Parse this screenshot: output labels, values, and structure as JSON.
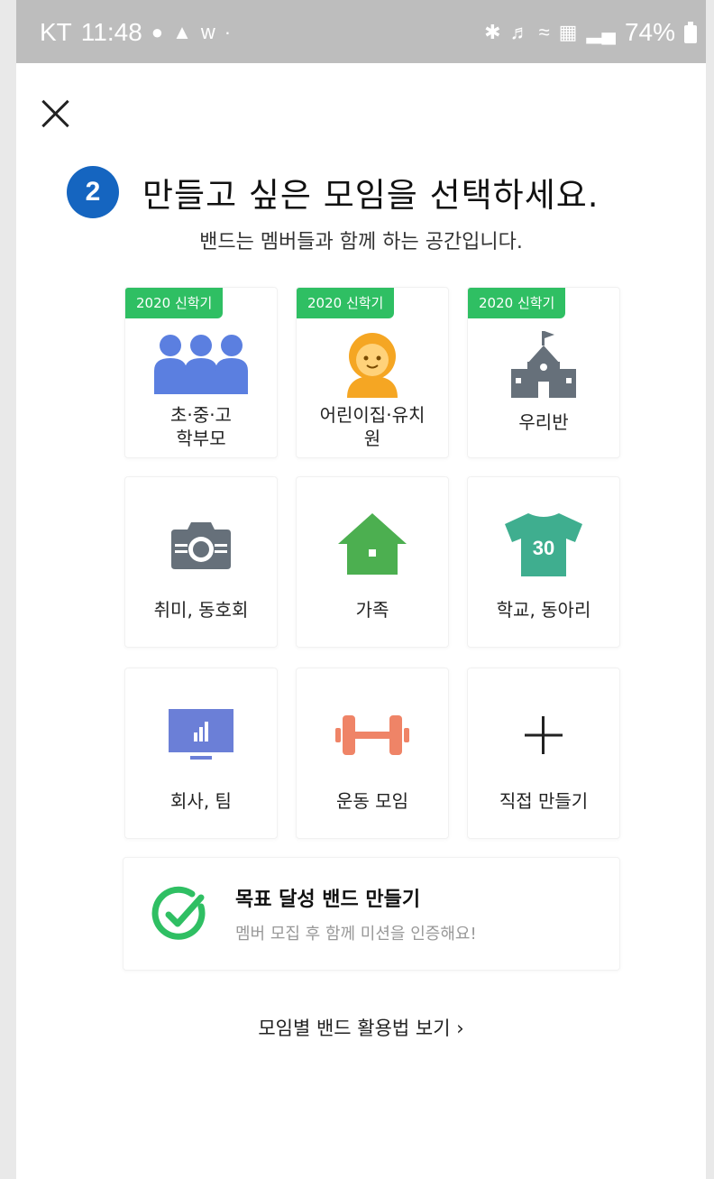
{
  "status_bar": {
    "carrier": "KT",
    "time": "11:48",
    "letter": "w",
    "battery": "74%"
  },
  "header": {
    "step_number": "2",
    "title": "만들고 싶은 모임을 선택하세요.",
    "subtitle": "밴드는 멤버들과 함께 하는 공간입니다."
  },
  "categories": [
    {
      "tag": "2020 신학기",
      "label_line1": "초·중·고",
      "label_line2": "학부모",
      "icon": "parents-group-icon",
      "color": "#5b7fe0"
    },
    {
      "tag": "2020 신학기",
      "label_line1": "어린이집·유치",
      "label_line2": "원",
      "icon": "baby-icon",
      "color": "#f5a623"
    },
    {
      "tag": "2020 신학기",
      "label_line1": "우리반",
      "icon": "school-building-icon",
      "color": "#66707a"
    },
    {
      "label_line1": "취미, 동호회",
      "icon": "camera-icon",
      "color": "#66707a"
    },
    {
      "label_line1": "가족",
      "icon": "house-icon",
      "color": "#4caf50"
    },
    {
      "label_line1": "학교, 동아리",
      "icon": "jersey-icon",
      "color": "#3fae8f",
      "icon_text": "30"
    },
    {
      "label_line1": "회사, 팀",
      "icon": "monitor-chart-icon",
      "color": "#6b7fd7"
    },
    {
      "label_line1": "운동 모임",
      "icon": "dumbbell-icon",
      "color": "#ef8467"
    },
    {
      "label_line1": "직접 만들기",
      "icon": "plus-icon",
      "color": "#222222"
    }
  ],
  "goal_band": {
    "title": "목표 달성 밴드 만들기",
    "description": "멤버 모집 후 함께 미션을 인증해요!",
    "icon": "check-circle-icon",
    "color": "#2fbf63"
  },
  "guide_link": {
    "label": "모임별 밴드 활용법 보기 ›"
  },
  "colors": {
    "accent_blue": "#1565c0",
    "tag_green": "#2fbf63"
  }
}
